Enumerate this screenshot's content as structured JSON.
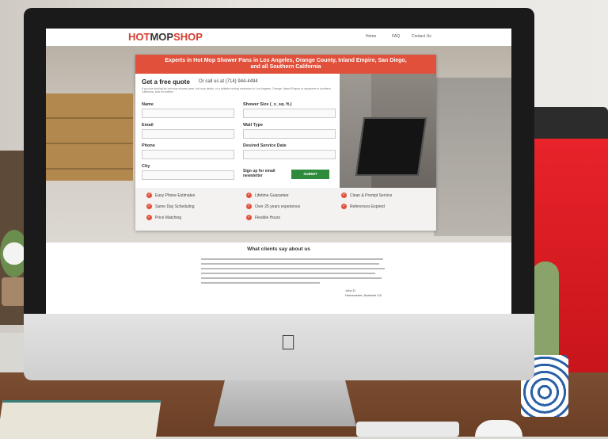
{
  "site": {
    "logo_hot": "HOT",
    "logo_mop": "MOP",
    "logo_shop": "SHOP",
    "nav": [
      "Home",
      "FAQ",
      "Contact Us"
    ]
  },
  "banner": {
    "line1": "Experts in Hot Mop Shower Pans in Los Angeles, Orange County, Inland Empire, San Diego,",
    "line2": "and all Southern California"
  },
  "quote": {
    "title": "Get a free quote",
    "call": "Or call us at (714) 944-4494",
    "description": "If you are looking for hot mop shower pans, hot mop decks, or a reliable roofing contractor in Los Angeles, Orange, Inland Empire or anywhere in southern California, look no further!"
  },
  "form": {
    "fields": [
      "Name",
      "Shower Size (_x_sq. ft.)",
      "Email",
      "Wall Type",
      "Phone",
      "Desired Service Date",
      "City"
    ],
    "signup_label": "Sign up for email newsletter",
    "submit_label": "SUBMIT"
  },
  "features": [
    [
      "Easy Phone Estimates",
      "Lifetime Guarantee",
      "Clean & Prompt Service"
    ],
    [
      "Same Day Scheduling",
      "Over 25 years experience",
      "References Expired"
    ],
    [
      "Price Matching",
      "Flexible Hours",
      ""
    ]
  ],
  "clients": {
    "title": "What clients say about us",
    "author_name": "John D.",
    "author_place": "Homeowner, Anaheim CA"
  },
  "colors": {
    "accent": "#e0503a",
    "submit": "#2e8b3c",
    "couch": "#e8232a"
  }
}
